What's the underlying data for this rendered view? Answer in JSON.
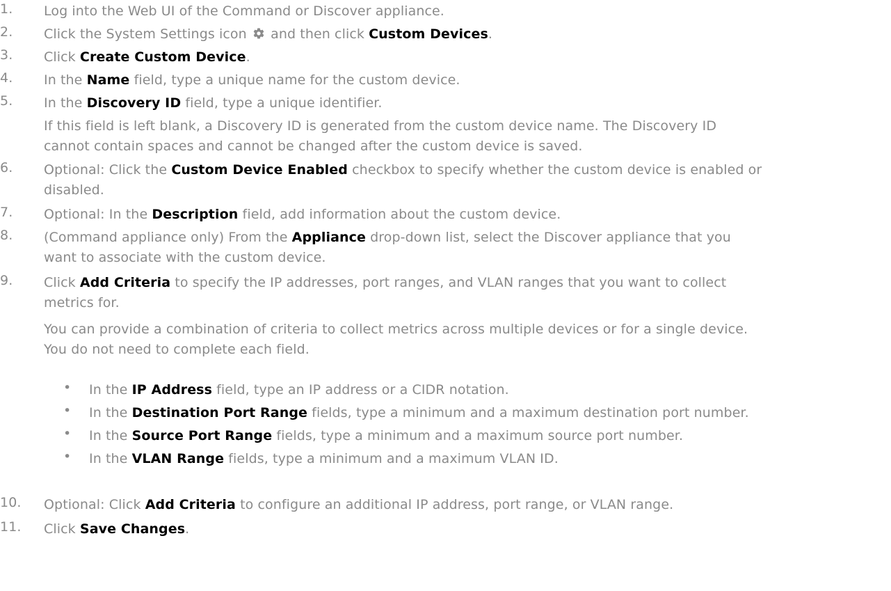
{
  "steps": [
    {
      "num": "1.",
      "text": "Log into the Web UI of the Command or Discover appliance."
    },
    {
      "num": "2.",
      "pre": "Click the System Settings icon",
      "mid": "and then click",
      "bold": "Custom Devices",
      "post": ".",
      "icon": "gear-icon"
    },
    {
      "num": "3.",
      "pre": "Click",
      "bold": "Create Custom Device",
      "post": "."
    },
    {
      "num": "4.",
      "pre": "In the",
      "bold": "Name",
      "post": "field, type a unique name for the custom device."
    },
    {
      "num": "5.",
      "pre": "In the",
      "bold": "Discovery ID",
      "post": "field, type a unique identifier.",
      "note_l1": "If this field is left blank, a Discovery ID is generated from the custom device name. The Discovery ID",
      "note_l2": "cannot contain spaces and cannot be changed after the custom device is saved."
    },
    {
      "num": "6.",
      "pre": "Optional: Click the",
      "bold": "Custom Device Enabled",
      "post": "checkbox to specify whether the custom device is enabled or",
      "l2": "disabled."
    },
    {
      "num": "7.",
      "pre": "Optional: In the",
      "bold": "Description",
      "post": "field, add information about the custom device."
    },
    {
      "num": "8.",
      "pre": "(Command appliance only) From the",
      "bold": "Appliance",
      "post": "drop-down list, select the Discover appliance that you",
      "l2": "want to associate with the custom device."
    },
    {
      "num": "9.",
      "pre": "Click",
      "bold": "Add Criteria",
      "post": "to specify the IP addresses, port ranges, and VLAN ranges that you want to collect",
      "l2": "metrics for.",
      "note_l1": "You can provide a combination of criteria to collect metrics across multiple devices or for a single device.",
      "note_l2": "You do not need to complete each field."
    },
    {
      "num": "10.",
      "pre": "Optional: Click",
      "bold": "Add Criteria",
      "post": "to configure an additional IP address, port range, or VLAN range."
    },
    {
      "num": "11.",
      "pre": "Click",
      "bold": "Save Changes",
      "post": "."
    }
  ],
  "bullets": [
    {
      "dot": "•",
      "pre": "In the",
      "bold": "IP Address",
      "post": "field, type an IP address or a CIDR notation."
    },
    {
      "dot": "•",
      "pre": "In the",
      "bold": "Destination Port Range",
      "post": "fields, type a minimum and a maximum destination port number."
    },
    {
      "dot": "•",
      "pre": "In the",
      "bold": "Source Port Range",
      "post": "fields, type a minimum and a maximum source port number."
    },
    {
      "dot": "•",
      "pre": "In the",
      "bold": "VLAN Range",
      "post": "fields, type a minimum and a maximum VLAN ID."
    }
  ],
  "colors": {
    "text": "#8a8a8a",
    "emphasis": "#000000",
    "icon": "#8a8a8a"
  }
}
